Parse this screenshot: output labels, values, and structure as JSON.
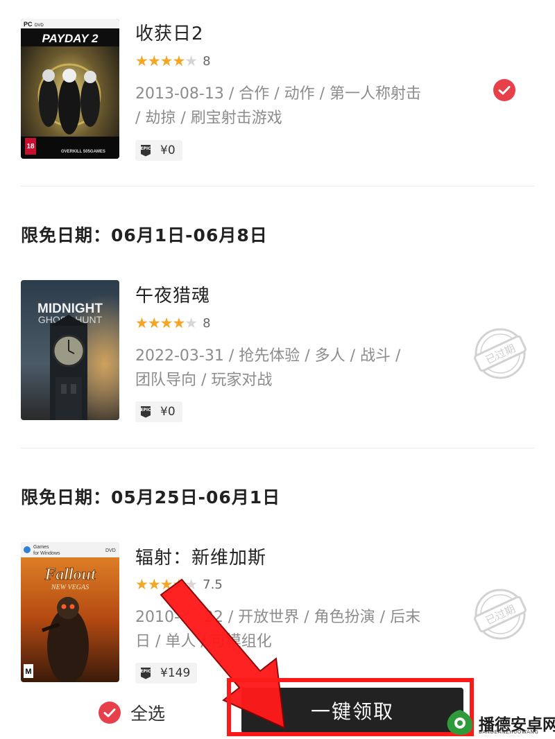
{
  "games": [
    {
      "title": "收获日2",
      "rating": 8,
      "score": "8",
      "meta_line1": "2013-08-13 / 合作 / 动作 / 第一人称射击",
      "meta_line2": "/ 劫掠 / 刷宝射击游戏",
      "price": "¥0",
      "store_icon": "epic-games-icon",
      "status": "selected",
      "cover": {
        "platform": "PC",
        "medium": "DVD",
        "logo": "PAYDAY 2",
        "rating_badge": "18",
        "publisher": "OVERKILL 505GAMES"
      }
    },
    {
      "section_header": "限免日期：06月1日-06月8日",
      "title": "午夜猎魂",
      "rating": 8,
      "score": "8",
      "meta_line1": "2022-03-31 / 抢先体验 / 多人 / 战斗 /",
      "meta_line2": "团队导向 / 玩家对战",
      "price": "¥0",
      "store_icon": "epic-games-icon",
      "status": "expired",
      "status_label": "已过期",
      "cover": {
        "logo_line1": "MIDNIGHT",
        "logo_line2": "GHOST HUNT"
      }
    },
    {
      "section_header": "限免日期：05月25日-06月1日",
      "title": "辐射：新维加斯",
      "rating": 7.5,
      "score": "7.5",
      "meta_line1": "2010-     22 / 开放世界 / 角色扮演 / 后末",
      "meta_line2": "日 / 单人 / 可模组化",
      "price": "¥149",
      "store_icon": "epic-games-icon",
      "status": "expired",
      "status_label": "已过期",
      "cover": {
        "top_line1": "Games",
        "top_line2": "for Windows",
        "medium": "DVD",
        "logo_line1": "Fallout",
        "logo_line2": "NEW VEGAS",
        "rating_badge": "M"
      }
    }
  ],
  "footer": {
    "select_all_label": "全选",
    "claim_button_label": "一键领取"
  },
  "watermark": {
    "title": "播德安卓网",
    "subtitle": "BANDEANZHUOWANG"
  },
  "colors": {
    "accent_red": "#e8404a",
    "star": "#f5a623",
    "annotation_red": "#ff1a1a"
  }
}
